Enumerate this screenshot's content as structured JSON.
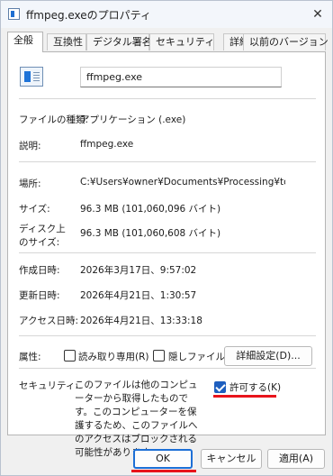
{
  "window": {
    "title": "ffmpeg.exeのプロパティ",
    "close_glyph": "✕"
  },
  "tabs": [
    "全般",
    "互換性",
    "デジタル署名",
    "セキュリティ",
    "詳細",
    "以前のバージョン"
  ],
  "general": {
    "file_name": "ffmpeg.exe",
    "file_type_label": "ファイルの種類:",
    "file_type_value": "アプリケーション (.exe)",
    "description_label": "説明:",
    "description_value": "ffmpeg.exe",
    "location_label": "場所:",
    "location_value": "C:¥Users¥owner¥Documents¥Processing¥tools¥M",
    "size_label": "サイズ:",
    "size_value": "96.3 MB (101,060,096 バイト)",
    "disk_size_label_1": "ディスク上",
    "disk_size_label_2": "のサイズ:",
    "disk_size_value": "96.3 MB (101,060,608 バイト)",
    "created_label": "作成日時:",
    "created_value": "2026年3月17日、9:57:02",
    "modified_label": "更新日時:",
    "modified_value": "2026年4月21日、1:30:57",
    "accessed_label": "アクセス日時:",
    "accessed_value": "2026年4月21日、13:33:18",
    "attributes_label": "属性:",
    "readonly_label": "読み取り専用(R)",
    "hidden_label": "隠しファイル(H)",
    "advanced_button": "詳細設定(D)...",
    "security_label": "セキュリティ:",
    "security_text": "このファイルは他のコンピューターから取得したものです。このコンピューターを保護するため、このファイルへのアクセスはブロックされる可能性があります。",
    "unblock_label": "許可する(K)",
    "unblock_checked": true,
    "readonly_checked": false,
    "hidden_checked": false
  },
  "footer": {
    "ok": "OK",
    "cancel": "キャンセル",
    "apply": "適用(A)"
  },
  "colors": {
    "accent": "#1e5fbf",
    "annotation": "#e8141b"
  },
  "icons": [
    "file-icon",
    "close-icon",
    "checkbox-checked-icon"
  ]
}
